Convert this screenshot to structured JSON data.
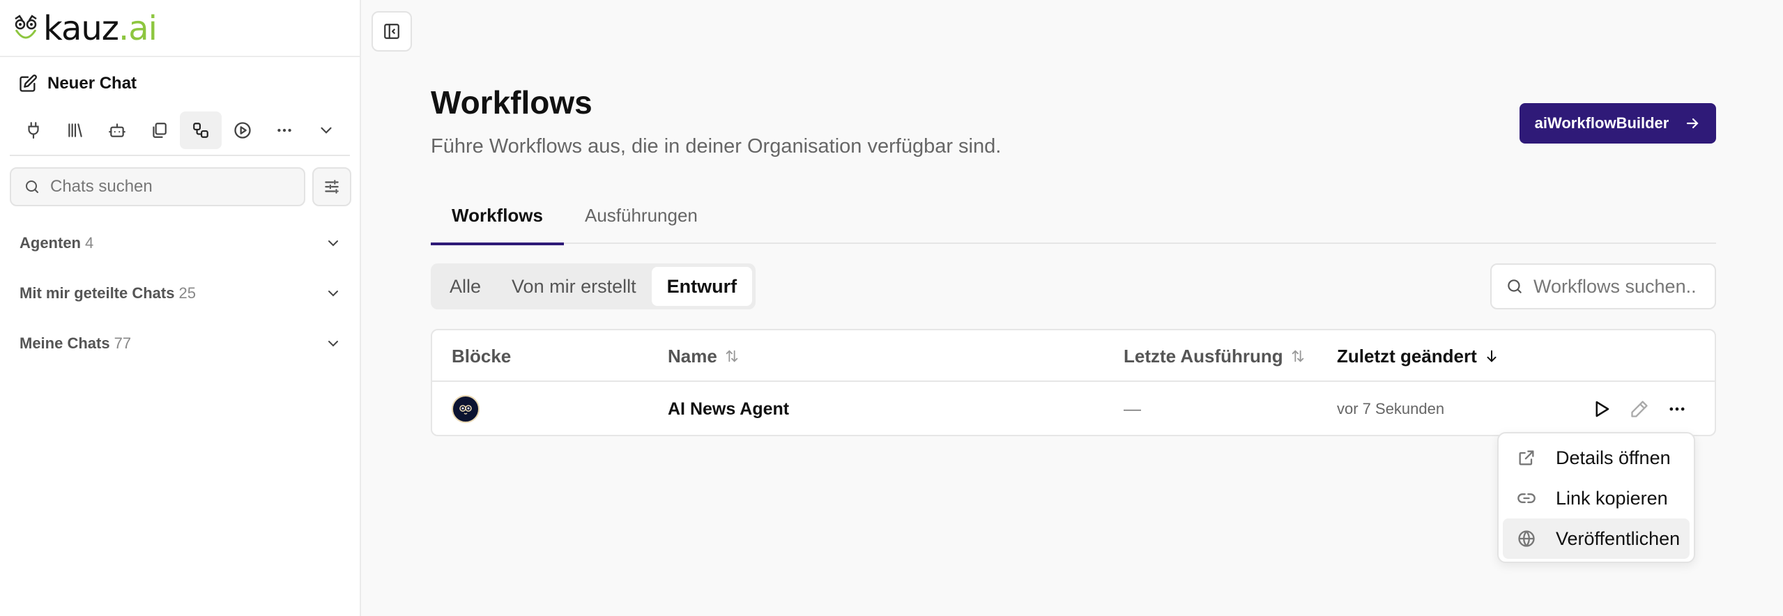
{
  "brand": {
    "name_main": "kauz",
    "name_dot": ".ai"
  },
  "sidebar": {
    "new_chat_label": "Neuer Chat",
    "search_placeholder": "Chats suchen",
    "sections": [
      {
        "label": "Agenten",
        "count": "4"
      },
      {
        "label": "Mit mir geteilte Chats",
        "count": "25"
      },
      {
        "label": "Meine Chats",
        "count": "77"
      }
    ],
    "toolbar_icons": [
      "plug-icon",
      "library-icon",
      "bot-icon",
      "files-icon",
      "workflow-icon",
      "play-circle-icon",
      "more-icon",
      "chevron-down-icon"
    ]
  },
  "page": {
    "title": "Workflows",
    "subtitle": "Führe Workflows aus, die in deiner Organisation verfügbar sind.",
    "builder_button": "aiWorkflowBuilder"
  },
  "tabs": [
    "Workflows",
    "Ausführungen"
  ],
  "filters": [
    "Alle",
    "Von mir erstellt",
    "Entwurf"
  ],
  "active_filter": "Entwurf",
  "workflow_search_placeholder": "Workflows suchen..",
  "table": {
    "columns": {
      "blocks": "Blöcke",
      "name": "Name",
      "last_run": "Letzte Ausführung",
      "modified": "Zuletzt geändert"
    },
    "rows": [
      {
        "name": "AI News Agent",
        "last_run": "—",
        "modified": "vor 7 Sekunden"
      }
    ]
  },
  "context_menu": [
    "Details öffnen",
    "Link kopieren",
    "Veröffentlichen"
  ],
  "colors": {
    "accent": "#2f1a78",
    "brand_green": "#8dc63f"
  }
}
